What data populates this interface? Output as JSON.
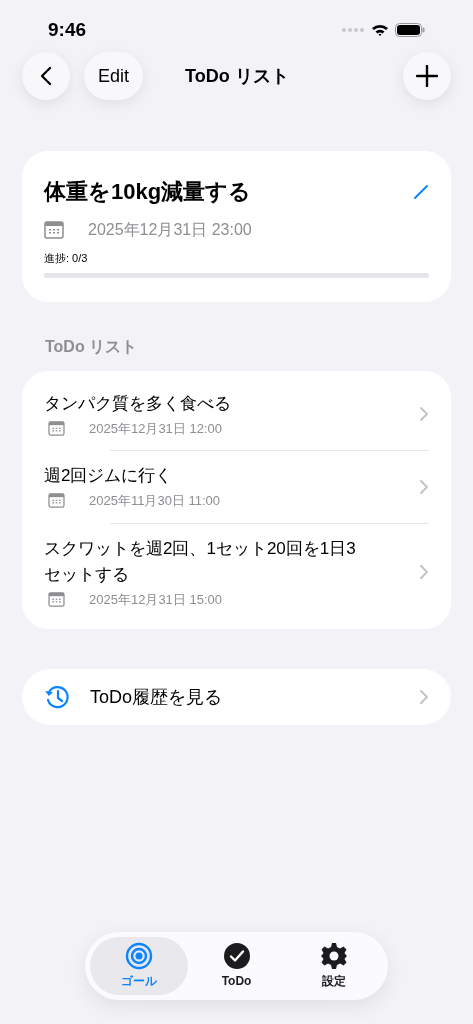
{
  "status_bar": {
    "time": "9:46"
  },
  "nav": {
    "edit": "Edit",
    "title": "ToDo リスト"
  },
  "goal": {
    "title": "体重を10kg減量する",
    "date": "2025年12月31日 23:00",
    "progress_label": "進捗: 0/3",
    "level": 0
  },
  "section_title": "ToDo リスト",
  "todos": [
    {
      "title": "タンパク質を多く食べる",
      "date": "2025年12月31日 12:00"
    },
    {
      "title": "週2回ジムに行く",
      "date": "2025年11月30日 11:00"
    },
    {
      "title": "スクワットを週2回、1セット20回を1日3セットする",
      "date": "2025年12月31日 15:00"
    }
  ],
  "history": {
    "label": "ToDo履歴を見る"
  },
  "tabs": [
    {
      "kind": "goal",
      "label": "ゴール",
      "selected": true
    },
    {
      "kind": "todo",
      "label": "ToDo",
      "selected": false
    },
    {
      "kind": "settings",
      "label": "設定",
      "selected": false
    }
  ]
}
